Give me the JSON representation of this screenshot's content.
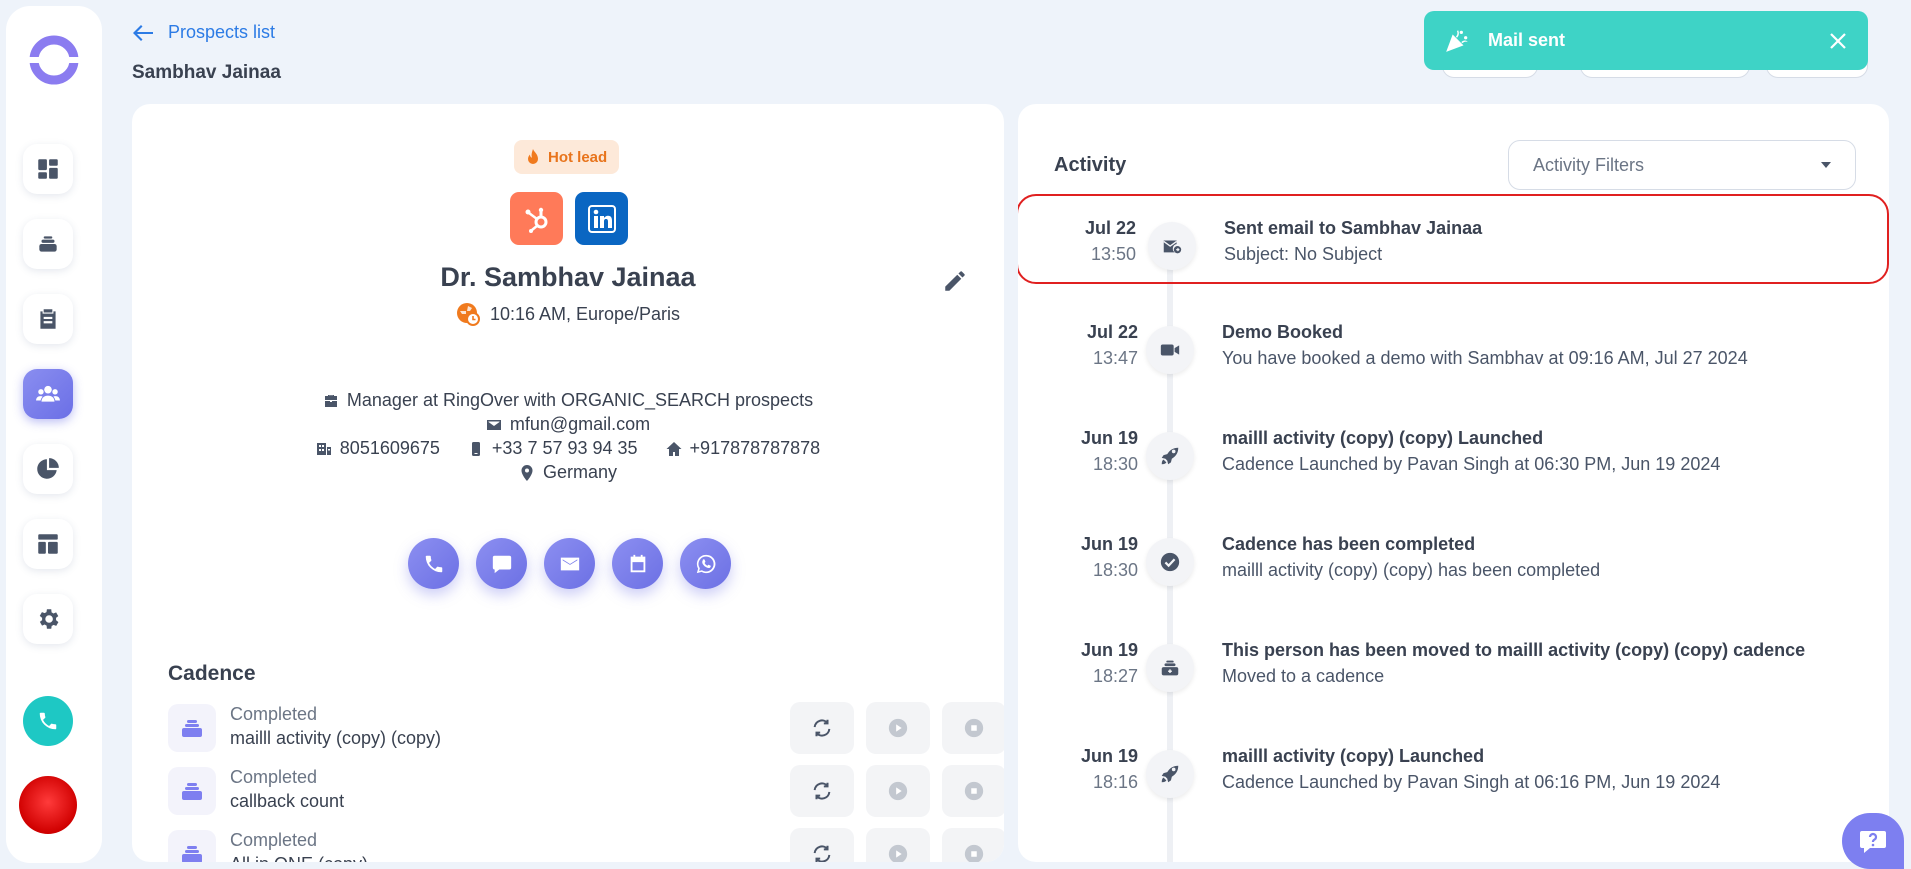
{
  "header": {
    "back_label": "Prospects list",
    "prospect_title": "Sambhav Jainaa"
  },
  "toast": {
    "message": "Mail sent"
  },
  "profile": {
    "badge": "Hot lead",
    "name": "Dr. Sambhav Jainaa",
    "local_time": "10:16 AM, Europe/Paris",
    "job": "Manager at RingOver with ORGANIC_SEARCH prospects",
    "email": "mfun@gmail.com",
    "office_phone": "8051609675",
    "mobile_phone": "+33 7 57 93 94 35",
    "home_phone": "+917878787878",
    "location": "Germany"
  },
  "cadence": {
    "title": "Cadence",
    "items": [
      {
        "status": "Completed",
        "name": "mailll activity (copy) (copy)"
      },
      {
        "status": "Completed",
        "name": "callback count"
      },
      {
        "status": "Completed",
        "name": "All in ONE (copy)"
      }
    ]
  },
  "activity": {
    "title": "Activity",
    "filter_label": "Activity Filters",
    "items": [
      {
        "date": "Jul 22",
        "time": "13:50",
        "title": "Sent email to Sambhav Jainaa",
        "subtitle": "Subject: No Subject",
        "icon": "mail-sent-icon"
      },
      {
        "date": "Jul 22",
        "time": "13:47",
        "title": "Demo Booked",
        "subtitle": "You have booked a demo with Sambhav at 09:16 AM, Jul 27 2024",
        "icon": "video-icon"
      },
      {
        "date": "Jun 19",
        "time": "18:30",
        "title": "mailll activity (copy) (copy) Launched",
        "subtitle": "Cadence Launched by Pavan Singh at 06:30 PM, Jun 19 2024",
        "icon": "rocket-icon"
      },
      {
        "date": "Jun 19",
        "time": "18:30",
        "title": "Cadence has been completed",
        "subtitle": "mailll activity (copy) (copy) has been completed",
        "icon": "check-circle-icon"
      },
      {
        "date": "Jun 19",
        "time": "18:27",
        "title": "This person has been moved to mailll activity (copy) (copy) cadence",
        "subtitle": "Moved to a cadence",
        "icon": "stack-move-icon"
      },
      {
        "date": "Jun 19",
        "time": "18:16",
        "title": "mailll activity (copy) Launched",
        "subtitle": "Cadence Launched by Pavan Singh at 06:16 PM, Jun 19 2024",
        "icon": "rocket-icon"
      }
    ]
  },
  "colors": {
    "accent": "#6b6fe6",
    "toast": "#3ed3c6",
    "link": "#2c7be5",
    "highlight": "#e02020",
    "hot_lead": "#e8741c"
  }
}
